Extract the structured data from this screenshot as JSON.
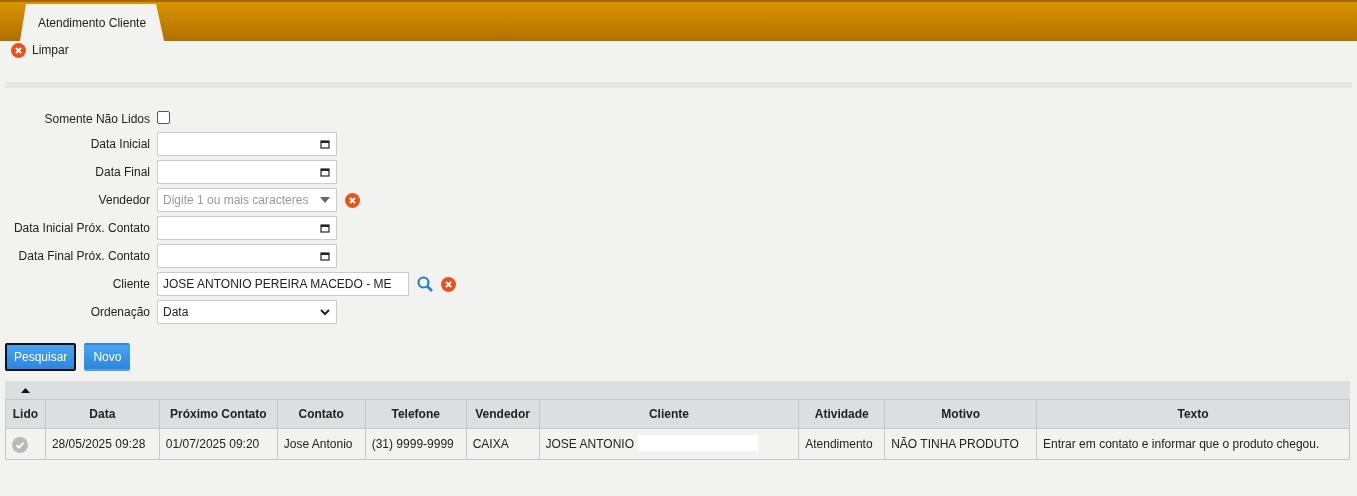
{
  "tabs": [
    {
      "label": "Atendimento Cliente",
      "selected": true
    }
  ],
  "clear_action": {
    "label": "Limpar"
  },
  "filters": [
    {
      "kind": "checkbox",
      "label": "Somente Não Lidos",
      "checked": false
    },
    {
      "kind": "date",
      "label": "Data Inicial"
    },
    {
      "kind": "date",
      "label": "Data Final"
    },
    {
      "kind": "autocomplete",
      "label": "Vendedor",
      "placeholder": "Digite 1 ou mais caracteres",
      "clearable": true
    },
    {
      "kind": "date",
      "label": "Data Inicial Próx. Contato"
    },
    {
      "kind": "date",
      "label": "Data Final Próx. Contato"
    },
    {
      "kind": "lookup",
      "label": "Cliente",
      "value": "JOSE ANTONIO PEREIRA MACEDO - ME",
      "clearable": true
    },
    {
      "kind": "select",
      "label": "Ordenação",
      "value": "Data"
    }
  ],
  "buttons": [
    {
      "label": "Pesquisar",
      "focused": true
    },
    {
      "label": "Novo",
      "focused": false
    }
  ],
  "table": {
    "columns": [
      "Lido",
      "Data",
      "Próximo Contato",
      "Contato",
      "Telefone",
      "Vendedor",
      "Cliente",
      "Atividade",
      "Motivo",
      "Texto"
    ],
    "rows": [
      {
        "read": true,
        "cells": [
          "",
          "28/05/2025 09:28",
          "01/07/2025 09:20",
          "Jose Antonio",
          "(31) 9999-9999",
          "CAIXA",
          "JOSE ANTONIO",
          "Atendimento",
          "NÃO TINHA PRODUTO",
          "Entrar em contato e informar que o produto chegou."
        ],
        "redacted": true
      }
    ]
  }
}
